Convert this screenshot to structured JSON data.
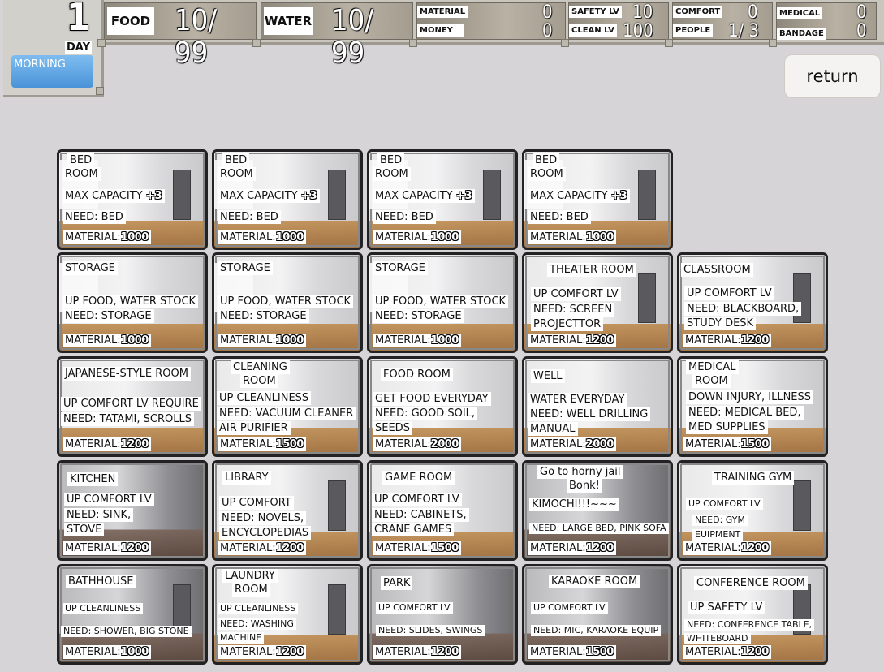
{
  "hud": {
    "day_number": "1",
    "day_label": "DAY",
    "time_of_day": "MORNING",
    "food": {
      "label": "FOOD",
      "value": "10/ 99"
    },
    "water": {
      "label": "WATER",
      "value": "10/ 99"
    },
    "material": {
      "label": "MATERIAL",
      "value": "0"
    },
    "money": {
      "label": "MONEY",
      "value": "0"
    },
    "safety_lv": {
      "label": "SAFETY LV",
      "value": "10"
    },
    "clean_lv": {
      "label": "CLEAN LV",
      "value": "100"
    },
    "comfort": {
      "label": "COMFORT",
      "value": "0"
    },
    "people": {
      "label": "PEOPLE",
      "value": "1/ 3"
    },
    "medical": {
      "label": "MEDICAL",
      "value": "0"
    },
    "bandage": {
      "label": "BANDAGE",
      "value": "0"
    }
  },
  "return_label": "return",
  "rooms": {
    "r0c0": {
      "title1": "BED",
      "title2": "ROOM",
      "line1": "MAX CAPACITY",
      "bonus": "+3",
      "line2": "NEED: BED",
      "mat": "MATERIAL",
      "cost": "1000"
    },
    "r0c1": {
      "title1": "BED",
      "title2": "ROOM",
      "line1": "MAX CAPACITY",
      "bonus": "+3",
      "line2": "NEED: BED",
      "mat": "MATERIAL",
      "cost": "1000"
    },
    "r0c2": {
      "title1": "BED",
      "title2": "ROOM",
      "line1": "MAX CAPACITY",
      "bonus": "+3",
      "line2": "NEED: BED",
      "mat": "MATERIAL",
      "cost": "1000"
    },
    "r0c3": {
      "title1": "BED",
      "title2": "ROOM",
      "line1": "MAX CAPACITY",
      "bonus": "+3",
      "line2": "NEED: BED",
      "mat": "MATERIAL",
      "cost": "1000"
    },
    "r1c0": {
      "title": "STORAGE",
      "line1": "UP FOOD, WATER STOCK",
      "line2": "NEED: STORAGE",
      "mat": "MATERIAL",
      "cost": "1000"
    },
    "r1c1": {
      "title": "STORAGE",
      "line1": "UP FOOD, WATER STOCK",
      "line2": "NEED: STORAGE",
      "mat": "MATERIAL",
      "cost": "1000"
    },
    "r1c2": {
      "title": "STORAGE",
      "line1": "UP FOOD, WATER STOCK",
      "line2": "NEED: STORAGE",
      "mat": "MATERIAL",
      "cost": "1000"
    },
    "r1c3": {
      "title": "THEATER ROOM",
      "line1": "UP COMFORT LV",
      "line2": "NEED: SCREEN",
      "line3": "PROJECTTOR",
      "mat": "MATERIAL",
      "cost": "1200"
    },
    "r1c4": {
      "title": "CLASSROOM",
      "line1": "UP COMFORT LV",
      "line2": "NEED: BLACKBOARD,",
      "line3": "STUDY DESK",
      "mat": "MATERIAL",
      "cost": "1200"
    },
    "r2c0": {
      "title": "JAPANESE-STYLE ROOM",
      "line1": "UP COMFORT LV REQUIRE",
      "line2": "NEED: TATAMI, SCROLLS",
      "mat": "MATERIAL",
      "cost": "1200"
    },
    "r2c1": {
      "title1": "CLEANING",
      "title2": "ROOM",
      "line1": "UP CLEANLINESS",
      "line2": "NEED: VACUUM CLEANER",
      "line3": "AIR PURIFIER",
      "mat": "MATERIAL",
      "cost": "1500"
    },
    "r2c2": {
      "title": "FOOD ROOM",
      "line1": "GET FOOD EVERYDAY",
      "line2": "NEED: GOOD SOIL,",
      "line3": "SEEDS",
      "mat": "MATERIAL",
      "cost": "2000"
    },
    "r2c3": {
      "title": "WELL",
      "line1": "WATER EVERYDAY",
      "line2": "NEED: WELL DRILLING",
      "line3": "MANUAL",
      "mat": "MATERIAL",
      "cost": "2000"
    },
    "r2c4": {
      "title1": "MEDICAL",
      "title2": "ROOM",
      "line1": "DOWN INJURY, ILLNESS",
      "line2": "NEED: MEDICAL BED,",
      "line3": "MED SUPPLIES",
      "mat": "MATERIAL",
      "cost": "1500"
    },
    "r3c0": {
      "title": "KITCHEN",
      "line1": "UP COMFORT LV",
      "line2": "NEED: SINK,",
      "line3": "STOVE",
      "mat": "MATERIAL",
      "cost": "1200"
    },
    "r3c1": {
      "title": "LIBRARY",
      "line1": "UP COMFORT",
      "line2": "NEED: NOVELS,",
      "line3": "ENCYCLOPEDIAS",
      "mat": "MATERIAL",
      "cost": "1200"
    },
    "r3c2": {
      "title": "GAME ROOM",
      "line1": "UP COMFORT LV",
      "line2": "NEED: CABINETS,",
      "line3": "CRANE GAMES",
      "mat": "MATERIAL",
      "cost": "1500"
    },
    "r3c3": {
      "title1": "Go to horny jail",
      "title2": "Bonk!",
      "line1": "KIMOCHI!!!~~~",
      "line2": "NEED: LARGE BED, PINK SOFA",
      "mat": "MATERIAL",
      "cost": "1200"
    },
    "r3c4": {
      "title": "TRAINING GYM",
      "line1": "UP COMFORT LV",
      "line2": "NEED: GYM",
      "line3": "EUIPMENT",
      "mat": "MATERIAL",
      "cost": "1200"
    },
    "r4c0": {
      "title": "BATHHOUSE",
      "line1": "UP CLEANLINESS",
      "line2": "NEED: SHOWER, BIG STONE",
      "mat": "MATERIAL",
      "cost": "1000"
    },
    "r4c1": {
      "title1": "LAUNDRY",
      "title2": "ROOM",
      "line1": "UP CLEANLINESS",
      "line2": "NEED: WASHING",
      "line3": "MACHINE",
      "mat": "MATERIAL",
      "cost": "1200"
    },
    "r4c2": {
      "title": "PARK",
      "line1": "UP COMFORT LV",
      "line2": "NEED: SLIDES, SWINGS",
      "mat": "MATERIAL",
      "cost": "1200"
    },
    "r4c3": {
      "title": "KARAOKE ROOM",
      "line1": "UP COMFORT LV",
      "line2": "NEED: MIC, KARAOKE EQUIP",
      "mat": "MATERIAL",
      "cost": "1500"
    },
    "r4c4": {
      "title": "CONFERENCE ROOM",
      "line1": "UP SAFETY LV",
      "line2": "NEED: CONFERENCE TABLE,",
      "line3": "WHITEBOARD",
      "mat": "MATERIAL",
      "cost": "1200"
    }
  }
}
